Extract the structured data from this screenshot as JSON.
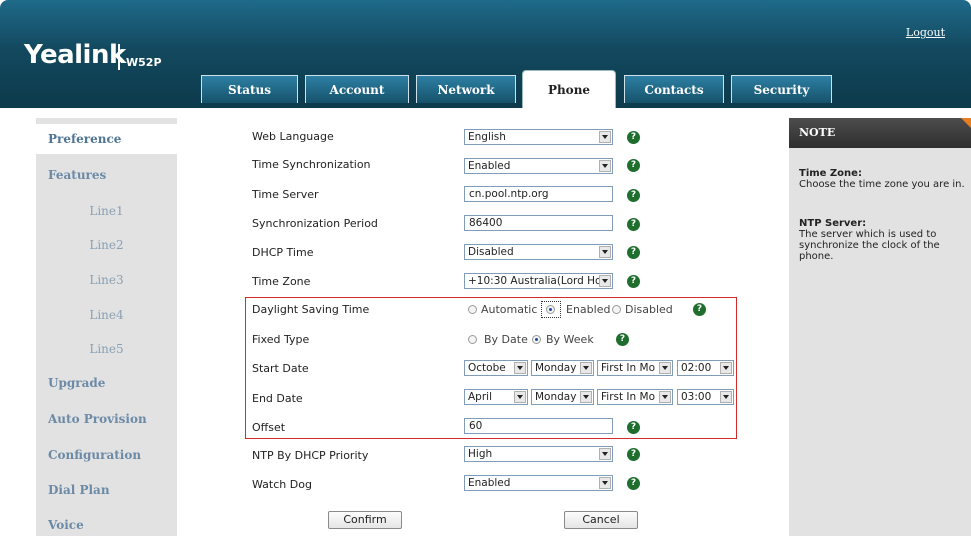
{
  "header": {
    "brand": "Yealink",
    "model": "W52P",
    "logout": "Logout",
    "tabs": [
      "Status",
      "Account",
      "Network",
      "Phone",
      "Contacts",
      "Security"
    ]
  },
  "nav": {
    "items": [
      "Preference",
      "Features",
      "Line1",
      "Line2",
      "Line3",
      "Line4",
      "Line5",
      "Upgrade",
      "Auto Provision",
      "Configuration",
      "Dial Plan",
      "Voice"
    ]
  },
  "note": {
    "heading": "NOTE",
    "tz_title": "Time Zone:",
    "tz_text": "Choose the time zone you are in.",
    "ntp_title": "NTP Server:",
    "ntp_text": "The server which is used to synchronize the clock of the phone."
  },
  "form": {
    "web_language": {
      "label": "Web Language",
      "value": "English"
    },
    "time_sync": {
      "label": "Time Synchronization",
      "value": "Enabled"
    },
    "time_server": {
      "label": "Time Server",
      "value": "cn.pool.ntp.org"
    },
    "sync_period": {
      "label": "Synchronization Period",
      "value": "86400"
    },
    "dhcp_time": {
      "label": "DHCP Time",
      "value": "Disabled"
    },
    "time_zone": {
      "label": "Time Zone",
      "value": "+10:30 Australia(Lord Ho"
    },
    "dst": {
      "label": "Daylight Saving Time",
      "options": [
        "Automatic",
        "Enabled",
        "Disabled"
      ],
      "selected": "Enabled"
    },
    "fixed_type": {
      "label": "Fixed Type",
      "options": [
        "By Date",
        "By Week"
      ],
      "selected": "By Week"
    },
    "start_date": {
      "label": "Start Date",
      "month": "Octobe",
      "day": "Monday",
      "week": "First In Mo",
      "time": "02:00"
    },
    "end_date": {
      "label": "End Date",
      "month": "April",
      "day": "Monday",
      "week": "First In Mo",
      "time": "03:00"
    },
    "offset": {
      "label": "Offset",
      "value": "60"
    },
    "ntp_priority": {
      "label": "NTP By DHCP Priority",
      "value": "High"
    },
    "watch_dog": {
      "label": "Watch Dog",
      "value": "Enabled"
    },
    "confirm": "Confirm",
    "cancel": "Cancel",
    "help_glyph": "?"
  }
}
